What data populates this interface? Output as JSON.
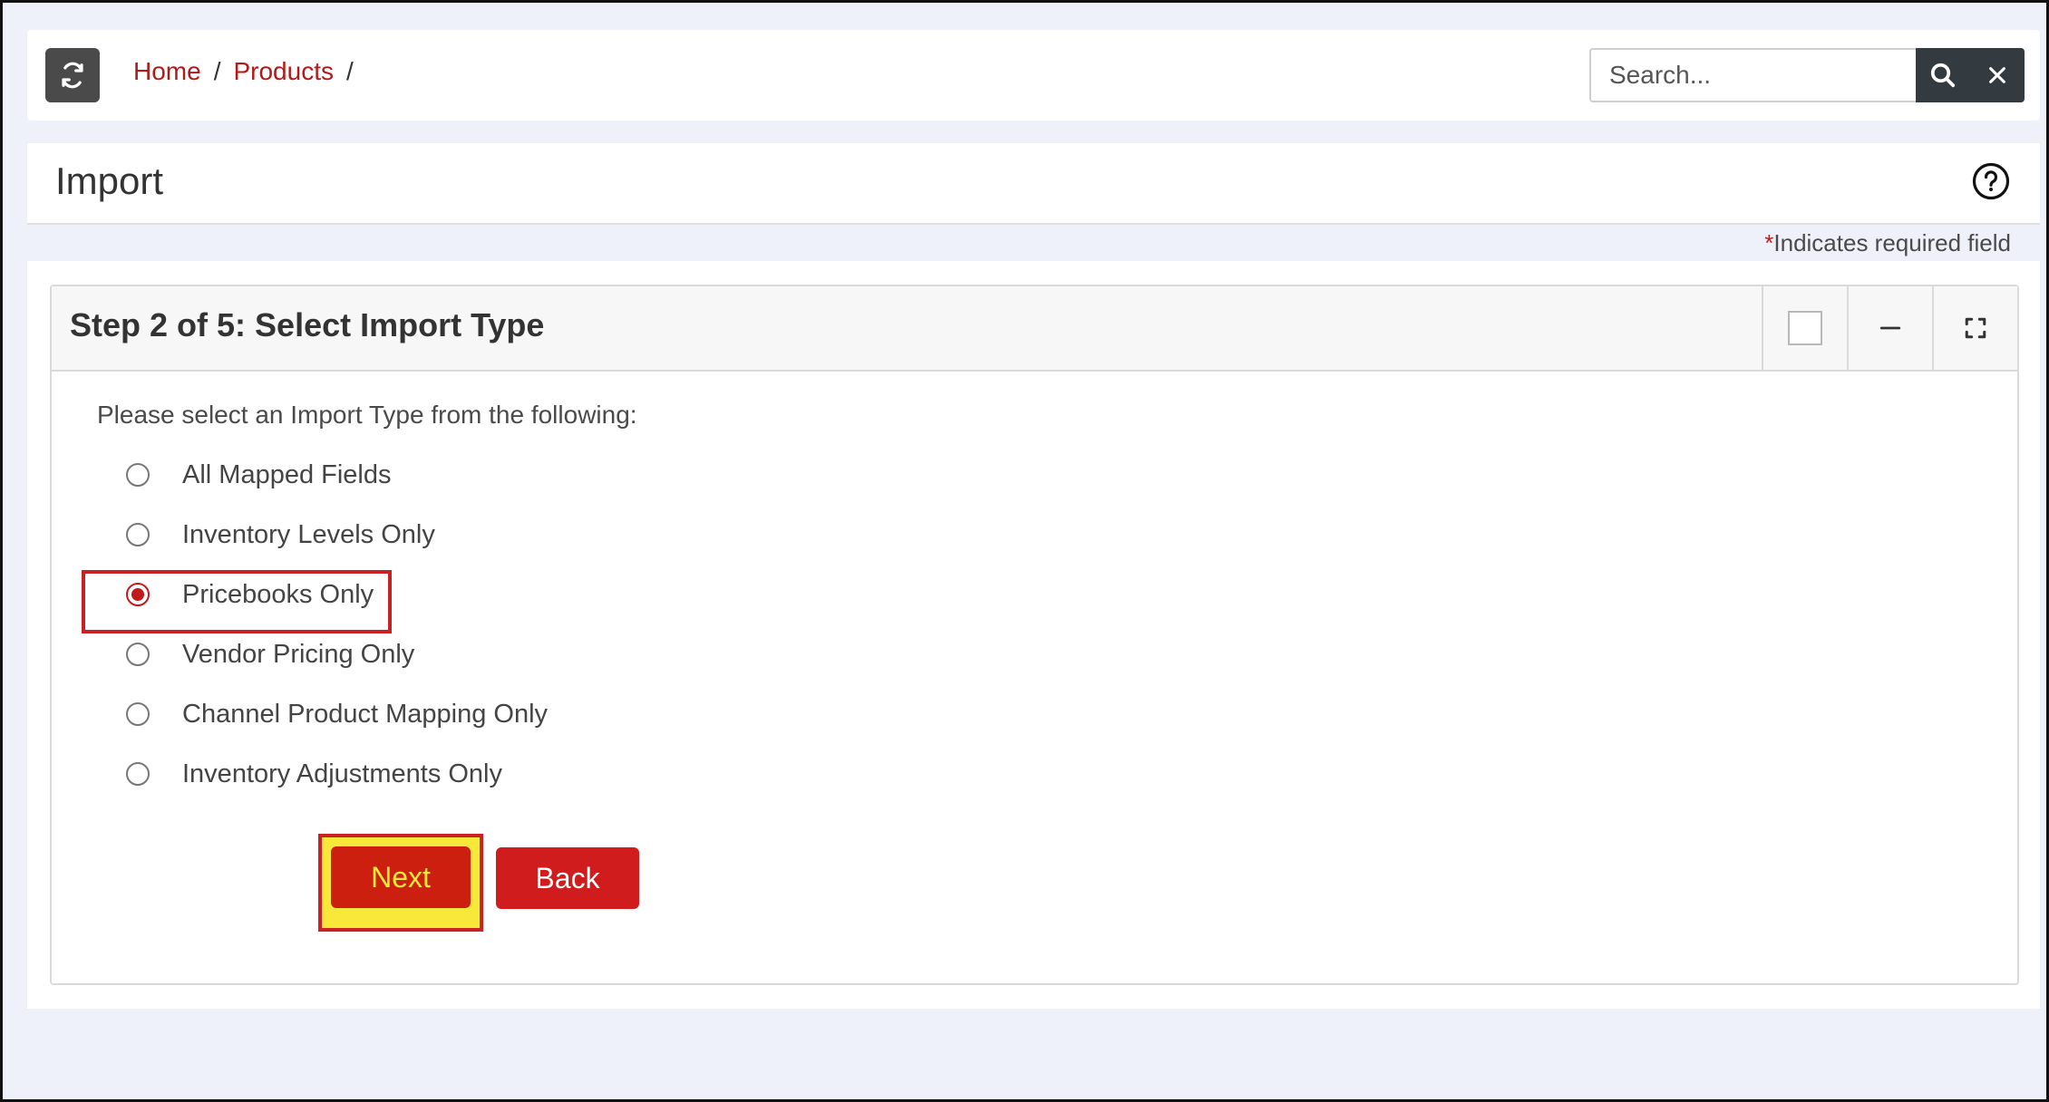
{
  "breadcrumb": {
    "home": "Home",
    "sep1": "/",
    "products": "Products",
    "sep2": "/"
  },
  "search": {
    "placeholder": "Search..."
  },
  "page": {
    "title": "Import",
    "required_star": "*",
    "required_text": "Indicates required field"
  },
  "card": {
    "title": "Step 2 of 5: Select Import Type",
    "instruction": "Please select an Import Type from the following:"
  },
  "options": [
    {
      "label": "All Mapped Fields",
      "checked": false
    },
    {
      "label": "Inventory Levels Only",
      "checked": false
    },
    {
      "label": "Pricebooks Only",
      "checked": true
    },
    {
      "label": "Vendor Pricing Only",
      "checked": false
    },
    {
      "label": "Channel Product Mapping Only",
      "checked": false
    },
    {
      "label": "Inventory Adjustments Only",
      "checked": false
    }
  ],
  "buttons": {
    "next": "Next",
    "back": "Back"
  },
  "colors": {
    "accent": "#c21a1a",
    "highlight": "#f7e83a",
    "dark": "#333a40"
  },
  "icons": [
    "refresh-icon",
    "search-icon",
    "close-icon",
    "help-icon",
    "minimize-icon",
    "expand-icon"
  ]
}
